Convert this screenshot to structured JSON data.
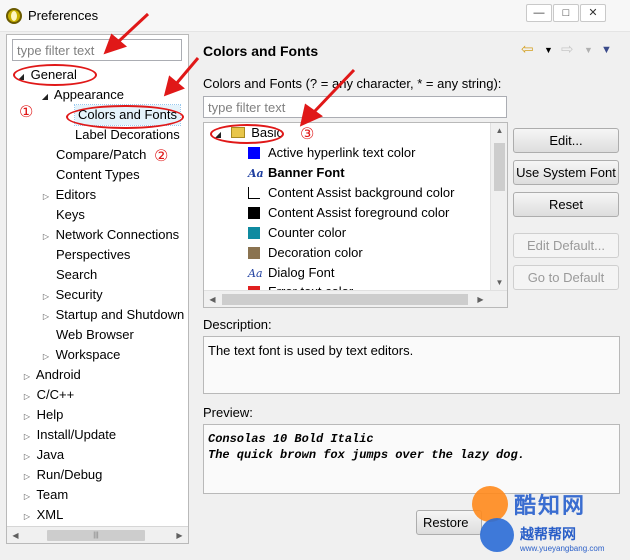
{
  "window": {
    "title": "Preferences",
    "minimize_glyph": "—",
    "restore_glyph": "□",
    "close_glyph": "✕"
  },
  "left": {
    "filter_placeholder": "type filter text",
    "tree": [
      {
        "label": "General",
        "twisty": "open"
      },
      {
        "label": "Appearance",
        "twisty": "open"
      },
      {
        "label": "Colors and Fonts",
        "twisty": "none"
      },
      {
        "label": "Label Decorations",
        "twisty": "none"
      },
      {
        "label": "Compare/Patch",
        "twisty": "none"
      },
      {
        "label": "Content Types",
        "twisty": "none"
      },
      {
        "label": "Editors",
        "twisty": "closed"
      },
      {
        "label": "Keys",
        "twisty": "none"
      },
      {
        "label": "Network Connections",
        "twisty": "closed"
      },
      {
        "label": "Perspectives",
        "twisty": "none"
      },
      {
        "label": "Search",
        "twisty": "none"
      },
      {
        "label": "Security",
        "twisty": "closed"
      },
      {
        "label": "Startup and Shutdown",
        "twisty": "closed"
      },
      {
        "label": "Web Browser",
        "twisty": "none"
      },
      {
        "label": "Workspace",
        "twisty": "closed"
      },
      {
        "label": "Android",
        "twisty": "closed"
      },
      {
        "label": "C/C++",
        "twisty": "closed"
      },
      {
        "label": "Help",
        "twisty": "closed"
      },
      {
        "label": "Install/Update",
        "twisty": "closed"
      },
      {
        "label": "Java",
        "twisty": "closed"
      },
      {
        "label": "Run/Debug",
        "twisty": "closed"
      },
      {
        "label": "Team",
        "twisty": "closed"
      },
      {
        "label": "XML",
        "twisty": "closed"
      }
    ]
  },
  "main": {
    "title": "Colors and Fonts",
    "hint": "Colors and Fonts (? = any character, * = any string):",
    "filter_placeholder": "type filter text",
    "category": "Basic",
    "items": [
      {
        "kind": "color",
        "label": "Active hyperlink text color",
        "color": "#0000ff"
      },
      {
        "kind": "font",
        "label": "Banner Font",
        "bold": true
      },
      {
        "kind": "color",
        "label": "Content Assist background color",
        "color": "#ffffff"
      },
      {
        "kind": "color",
        "label": "Content Assist foreground color",
        "color": "#000000"
      },
      {
        "kind": "color",
        "label": "Counter color",
        "color": "#0f8aa0"
      },
      {
        "kind": "color",
        "label": "Decoration color",
        "color": "#8a7350"
      },
      {
        "kind": "font",
        "label": "Dialog Font",
        "bold": false
      },
      {
        "kind": "color",
        "label": "Error text color",
        "color": "#e02020"
      }
    ],
    "buttons": {
      "edit": "Edit...",
      "use_system_font": "Use System Font",
      "reset": "Reset",
      "edit_default": "Edit Default...",
      "go_to_default": "Go to Default"
    },
    "description_label": "Description:",
    "description_text": "The text font is used by text editors.",
    "preview_label": "Preview:",
    "preview_lines": [
      "Consolas 10 Bold Italic",
      "The quick brown fox jumps over the lazy dog."
    ],
    "restore_label": "Restore Defaults"
  },
  "annotations": {
    "num1": "①",
    "num2": "②",
    "num3": "③",
    "accent": "#e01818"
  },
  "watermark": {
    "line1": "酷知网",
    "line2": "越帮帮网",
    "url": "www.yueyangbang.com"
  }
}
